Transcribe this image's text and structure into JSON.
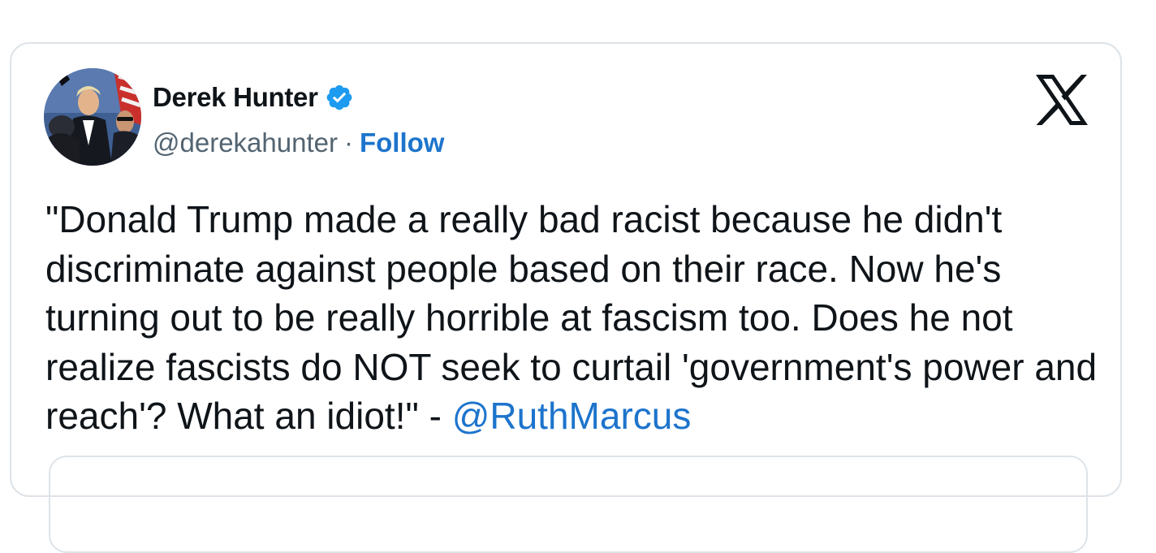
{
  "tweet": {
    "author": {
      "display_name": "Derek Hunter",
      "handle": "@derekahunter",
      "separator": "·",
      "follow_label": "Follow",
      "verified": true
    },
    "text_main": "\"Donald Trump made a really bad racist because he didn't discriminate against people based on their race. Now he's turning out to be really horrible at fascism too. Does he not realize fascists do NOT seek to curtail 'government's power and reach'? What an idiot!\" - ",
    "mention": "@RuthMarcus"
  },
  "icons": {
    "verified": "verified-badge-icon",
    "logo": "x-logo-icon"
  },
  "colors": {
    "text": "#0f1419",
    "secondary": "#536471",
    "link": "#1d74cc",
    "verified": "#1d9bf0",
    "border": "#dde3e8"
  }
}
